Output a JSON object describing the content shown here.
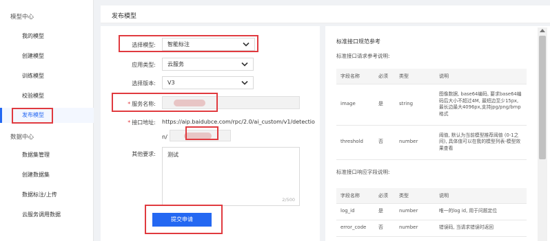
{
  "sidebar": {
    "group_model": "模型中心",
    "model_items": [
      {
        "label": "我的模型"
      },
      {
        "label": "创建模型"
      },
      {
        "label": "训练模型"
      },
      {
        "label": "校验模型"
      },
      {
        "label": "发布模型"
      }
    ],
    "group_data": "数据中心",
    "data_items": [
      {
        "label": "数据集管理"
      },
      {
        "label": "创建数据集"
      },
      {
        "label": "数据标注/上传"
      },
      {
        "label": "云服务调用数据"
      }
    ]
  },
  "header": {
    "title": "发布模型"
  },
  "form": {
    "select_model_label": "选择模型:",
    "select_model_value": "智能标注",
    "app_type_label": "应用类型:",
    "app_type_value": "云服务",
    "version_label": "选择版本:",
    "version_value": "V3",
    "service_name_label": "服务名称:",
    "api_address_label": "接口地址:",
    "api_address_line1": "https://aip.baidubce.com/rpc/2.0/ai_custom/v1/detectio",
    "api_address_line2_prefix": "n/",
    "other_label": "其他要求:",
    "other_value": "测试",
    "char_counter": "2/500",
    "submit_label": "提交申请"
  },
  "doc": {
    "request_heading": "标准接口规范参考",
    "request_sub": "标准接口请求参考说明:",
    "request_columns": [
      "字段名称",
      "必须",
      "类型",
      "说明"
    ],
    "request_rows": [
      {
        "name": "image",
        "required": "是",
        "type": "string",
        "desc": "图像数据, base64编码, 要求base64编码后大小不超过4M, 最短边至少15px, 最长边最大4096px,支持jpg/png/bmp格式"
      },
      {
        "name": "threshold",
        "required": "否",
        "type": "number",
        "desc": "阈值, 默认为当前模型推荐阈值 (0-1之间), 具体值可以在我的模型列表-模型效果查看"
      }
    ],
    "response_sub": "标准接口响应字段说明:",
    "response_columns": [
      "字段名称",
      "必须",
      "类型",
      "说明"
    ],
    "response_rows": [
      {
        "name": "log_id",
        "required": "是",
        "type": "number",
        "desc": "唯一的log id, 用于问题定位"
      },
      {
        "name": "error_code",
        "required": "否",
        "type": "number",
        "desc": "错误码, 当请求错误时返回"
      }
    ]
  },
  "colors": {
    "accent": "#2468f2",
    "highlight": "#e0393e"
  }
}
